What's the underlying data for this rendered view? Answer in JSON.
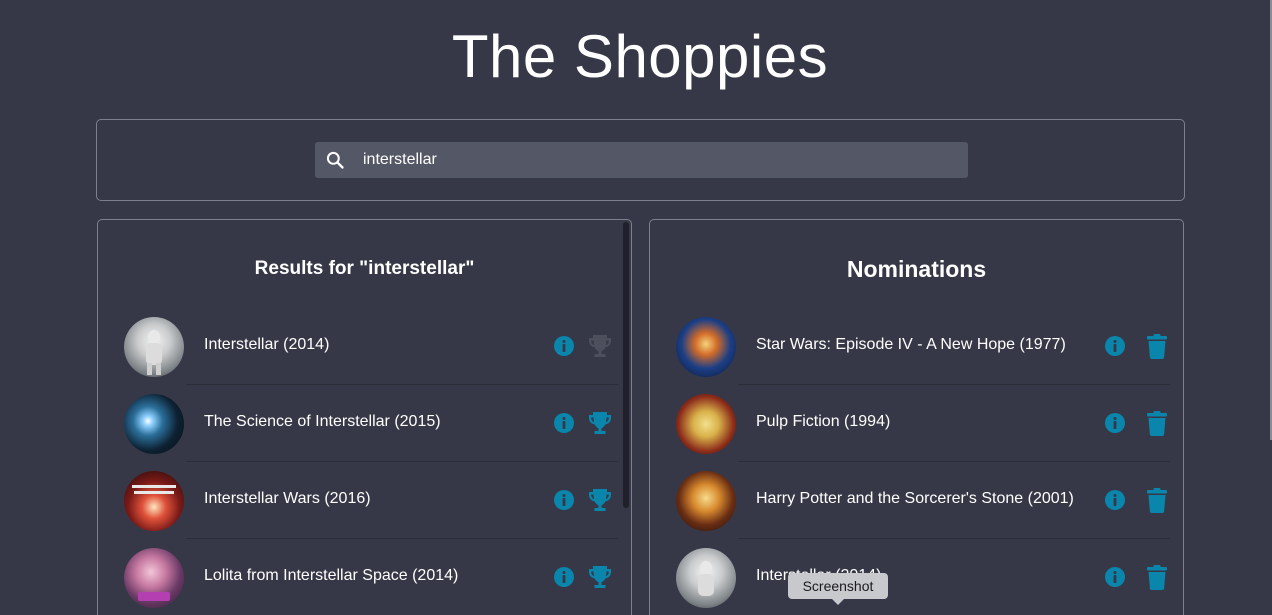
{
  "app": {
    "title": "The Shoppies"
  },
  "search": {
    "value": "interstellar",
    "placeholder": ""
  },
  "results": {
    "title": "Results for \"interstellar\"",
    "items": [
      {
        "label": "Interstellar (2014)",
        "nominated": true
      },
      {
        "label": "The Science of Interstellar (2015)",
        "nominated": false
      },
      {
        "label": "Interstellar Wars (2016)",
        "nominated": false
      },
      {
        "label": "Lolita from Interstellar Space (2014)",
        "nominated": false
      }
    ]
  },
  "nominations": {
    "title": "Nominations",
    "items": [
      {
        "label": "Star Wars: Episode IV - A New Hope (1977)"
      },
      {
        "label": "Pulp Fiction (1994)"
      },
      {
        "label": "Harry Potter and the Sorcerer's Stone (2001)"
      },
      {
        "label": "Interstellar (2014)"
      }
    ]
  },
  "tooltip": {
    "text": "Screenshot"
  },
  "colors": {
    "background": "#363847",
    "accent": "#0a85ab",
    "disabled": "#4d4f5c",
    "border": "#7c7f8e"
  },
  "icons": {
    "search": "search-icon",
    "info": "info-icon",
    "nominate": "trophy-icon",
    "remove": "trash-icon"
  }
}
